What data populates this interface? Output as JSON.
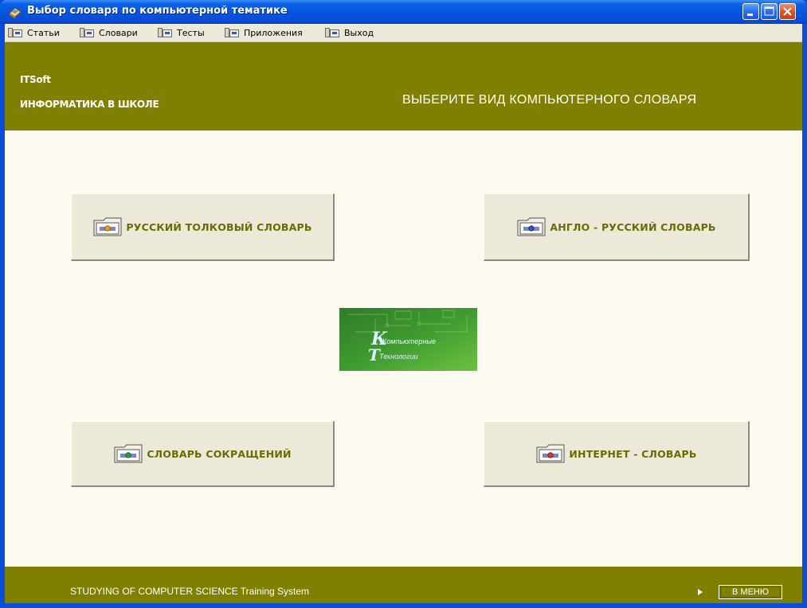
{
  "window": {
    "title": "Выбор словаря по компьютерной тематике"
  },
  "menubar": {
    "items": [
      {
        "label": "Статьи"
      },
      {
        "label": "Словари"
      },
      {
        "label": "Тесты"
      },
      {
        "label": "Приложения"
      },
      {
        "label": "Выход"
      }
    ]
  },
  "header": {
    "brand": "ITSoft",
    "subbrand": "ИНФОРМАТИКА В ШКОЛЕ",
    "title": "ВЫБЕРИТЕ ВИД КОМПЬЮТЕРНОГО СЛОВАРЯ"
  },
  "buttons": {
    "russian": "РУССКИЙ ТОЛКОВЫЙ СЛОВАРЬ",
    "english": "АНГЛО - РУССКИЙ СЛОВАРЬ",
    "abbreviations": "СЛОВАРЬ СОКРАЩЕНИЙ",
    "internet": "ИНТЕРНЕТ - СЛОВАРЬ"
  },
  "logo": {
    "line1": "Компьютерные",
    "line2": "Технологии"
  },
  "footer": {
    "text": "STUDYING OF COMPUTER SCIENCE Training System",
    "menu_button": "В МЕНЮ"
  },
  "colors": {
    "header_bg": "#808000",
    "content_bg": "#fdfbf1",
    "button_text": "#6b6b00",
    "titlebar": "#0553dd"
  }
}
